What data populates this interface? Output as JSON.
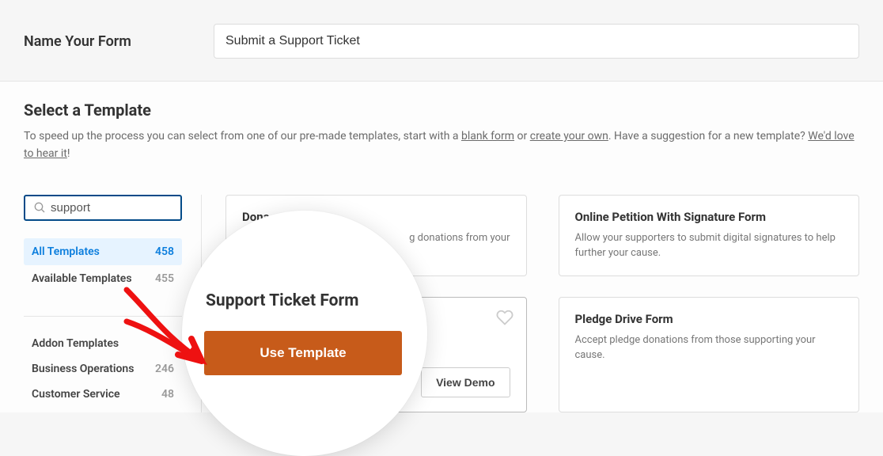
{
  "header": {
    "name_label": "Name Your Form",
    "name_value": "Submit a Support Ticket"
  },
  "intro": {
    "heading": "Select a Template",
    "desc_pre": "To speed up the process you can select from one of our pre-made templates, start with a ",
    "link_blank": "blank form",
    "desc_or": " or ",
    "link_create": "create your own",
    "desc_post": ". Have a suggestion for a new template? ",
    "link_hear": "We'd love to hear it",
    "desc_end": "!"
  },
  "sidebar": {
    "search_value": "support",
    "primary": [
      {
        "label": "All Templates",
        "count": 458,
        "active": true
      },
      {
        "label": "Available Templates",
        "count": 455,
        "active": false
      }
    ],
    "secondary": [
      {
        "label": "Addon Templates",
        "count": ""
      },
      {
        "label": "Business Operations",
        "count": 246
      },
      {
        "label": "Customer Service",
        "count": 48
      }
    ]
  },
  "templates": {
    "card1": {
      "title": "Dona",
      "desc_frag": "g donations from your"
    },
    "card2": {
      "title": "Online Petition With Signature Form",
      "desc": "Allow your supporters to submit digital signatures to help further your cause."
    },
    "card3": {
      "title": "Support Ticket Form",
      "view_demo": "View Demo"
    },
    "card4": {
      "title": "Pledge Drive Form",
      "desc": "Accept pledge donations from those supporting your cause."
    }
  },
  "magnifier": {
    "title": "Support Ticket Form",
    "button": "Use Template"
  }
}
